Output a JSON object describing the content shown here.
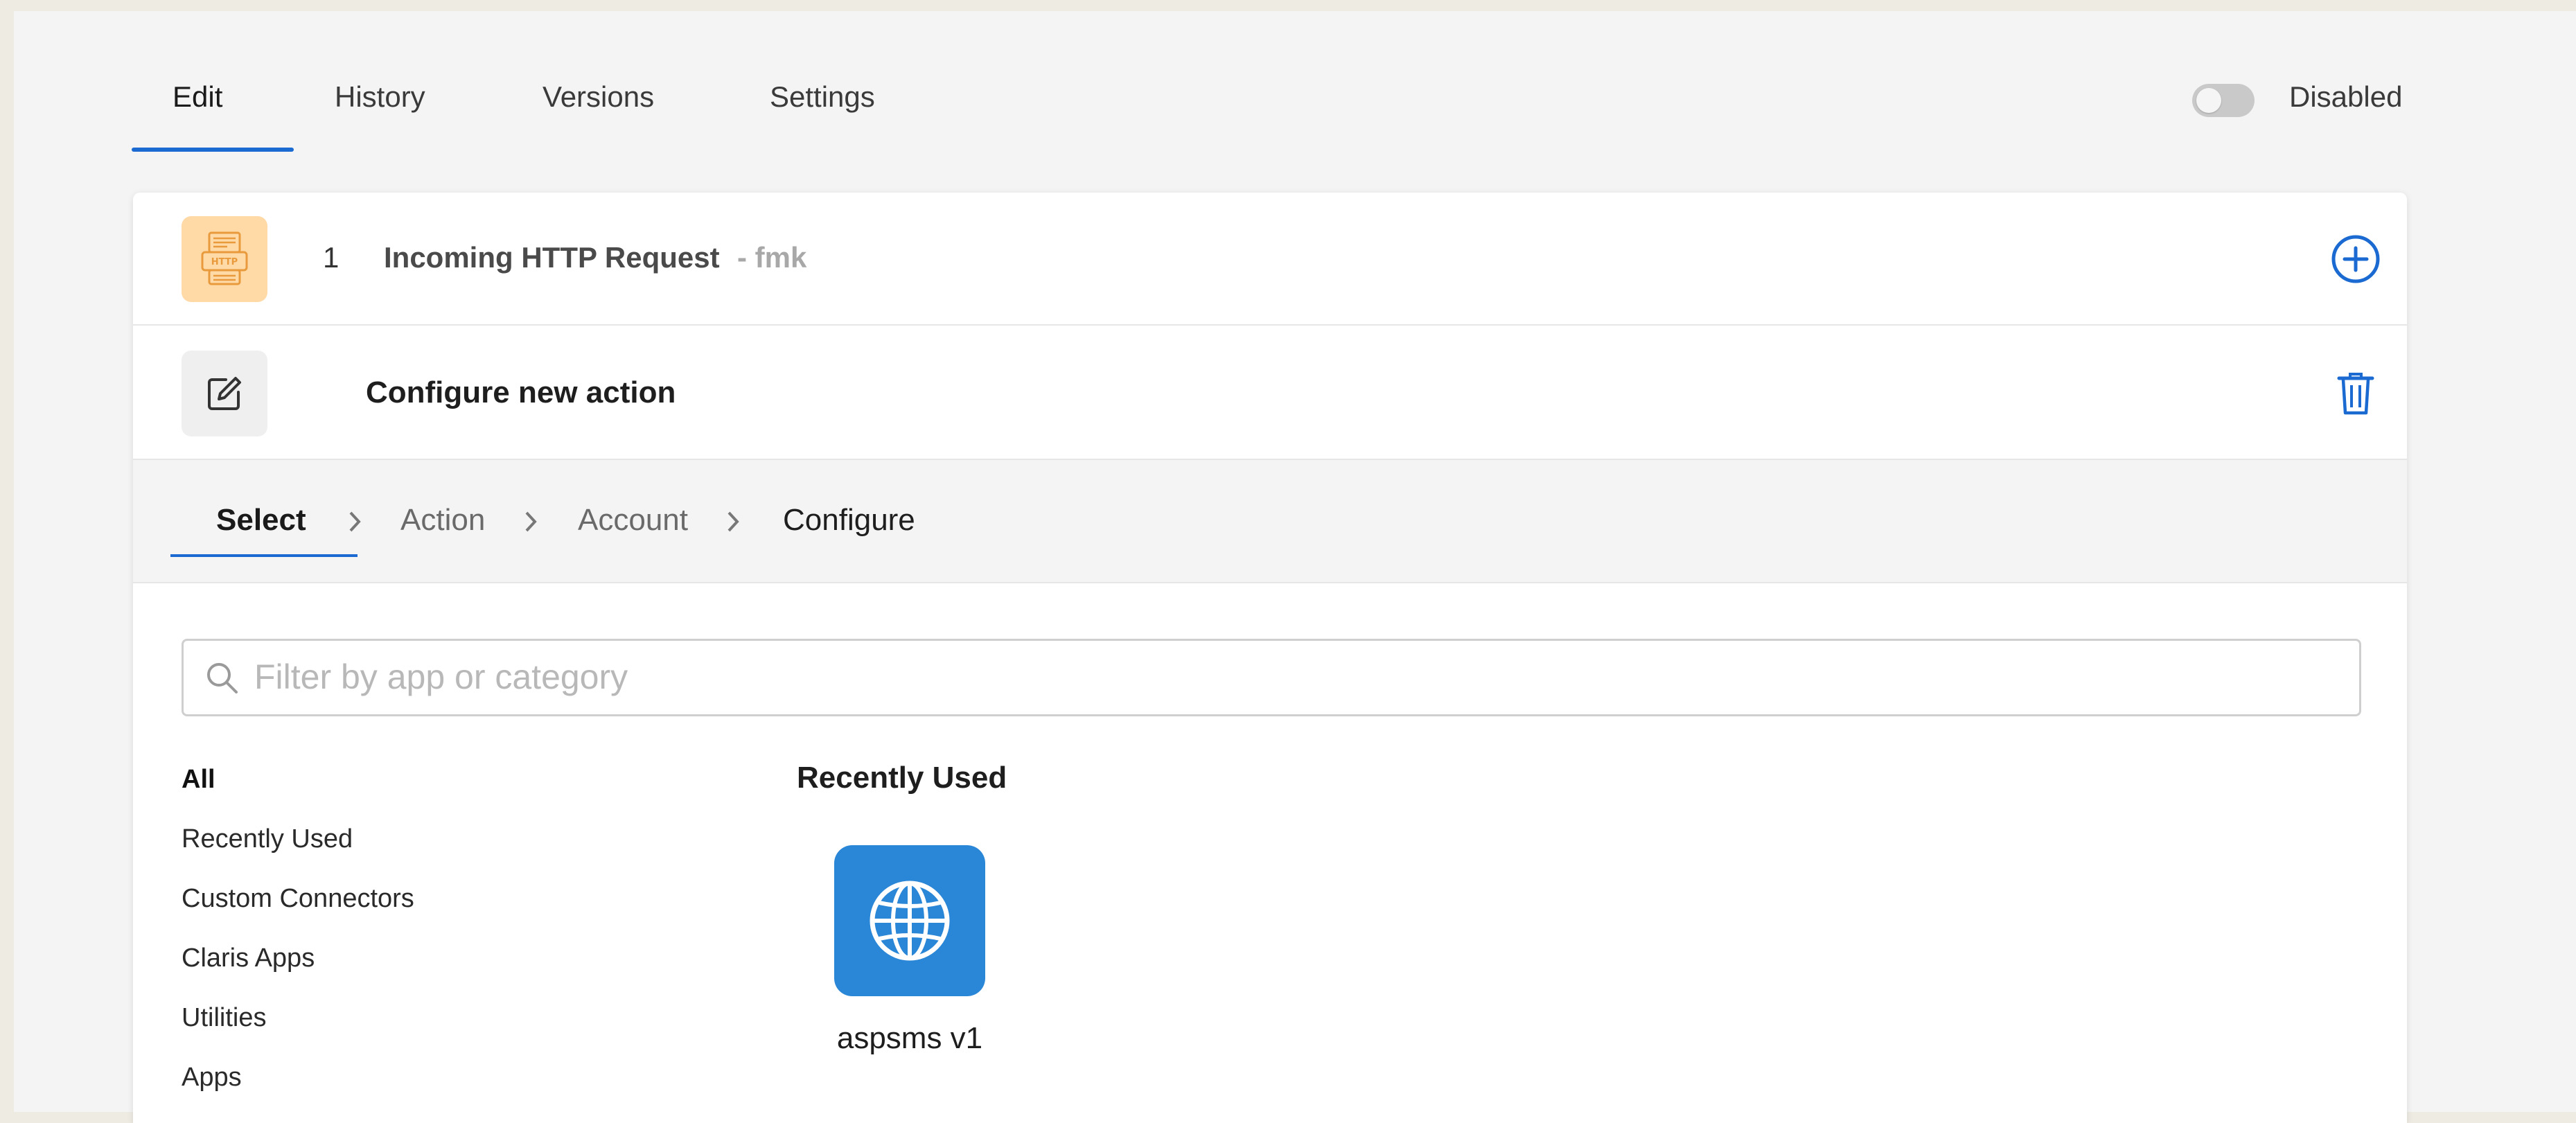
{
  "tabs": [
    {
      "label": "Edit"
    },
    {
      "label": "History"
    },
    {
      "label": "Versions"
    },
    {
      "label": "Settings"
    }
  ],
  "toggle": {
    "label": "Disabled",
    "on": false
  },
  "trigger_step": {
    "number": "1",
    "title": "Incoming HTTP Request",
    "subtitle": "- fmk",
    "icon": "http-document-icon"
  },
  "new_action": {
    "title": "Configure new action",
    "icon": "edit-square-icon"
  },
  "wizard": {
    "steps": [
      {
        "label": "Select"
      },
      {
        "label": "Action"
      },
      {
        "label": "Account"
      },
      {
        "label": "Configure"
      }
    ],
    "active_index": 0
  },
  "search": {
    "placeholder": "Filter by app or category",
    "value": ""
  },
  "categories": [
    {
      "label": "All"
    },
    {
      "label": "Recently Used"
    },
    {
      "label": "Custom Connectors"
    },
    {
      "label": "Claris Apps"
    },
    {
      "label": "Utilities"
    },
    {
      "label": "Apps"
    }
  ],
  "recent": {
    "title": "Recently Used",
    "apps": [
      {
        "name": "aspsms v1",
        "icon": "globe-icon",
        "color": "#2a86d6"
      }
    ]
  },
  "colors": {
    "accent": "#1a6ad1",
    "trigger_icon_bg": "#ffd9a6"
  }
}
